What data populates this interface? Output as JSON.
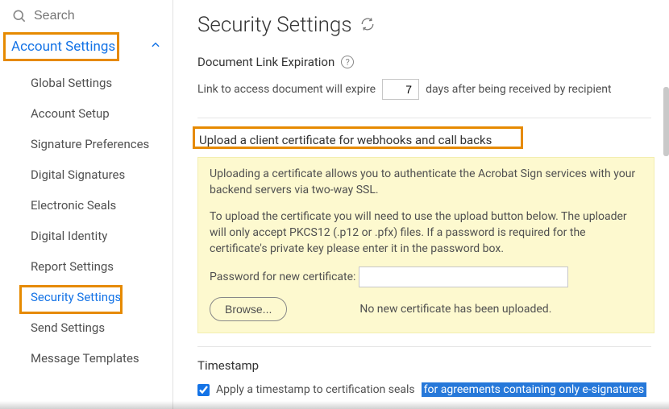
{
  "search": {
    "placeholder": "Search"
  },
  "sidebar": {
    "section_label": "Account Settings",
    "items": [
      {
        "label": "Global Settings"
      },
      {
        "label": "Account Setup"
      },
      {
        "label": "Signature Preferences"
      },
      {
        "label": "Digital Signatures"
      },
      {
        "label": "Electronic Seals"
      },
      {
        "label": "Digital Identity"
      },
      {
        "label": "Report Settings"
      },
      {
        "label": "Security Settings"
      },
      {
        "label": "Send Settings"
      },
      {
        "label": "Message Templates"
      }
    ]
  },
  "page": {
    "title": "Security Settings"
  },
  "expiration": {
    "heading": "Document Link Expiration",
    "prefix": "Link to access document will expire",
    "days": "7",
    "suffix": "days after being received by recipient"
  },
  "upload": {
    "heading": "Upload a client certificate for webhooks and call backs",
    "p1": "Uploading a certificate allows you to authenticate the Acrobat Sign services with your backend servers via two-way SSL.",
    "p2": "To upload the certificate you will need to use the upload button below. The uploader will only accept PKCS12 (.p12 or .pfx) files. If a password is required for the certificate's private key please enter it in the password box.",
    "pw_label": "Password for new certificate:",
    "browse_label": "Browse...",
    "status": "No new certificate has been uploaded."
  },
  "timestamp": {
    "heading": "Timestamp",
    "label_a": "Apply a timestamp to certification seals",
    "label_b": "for agreements containing only e-signatures",
    "checked": true
  }
}
